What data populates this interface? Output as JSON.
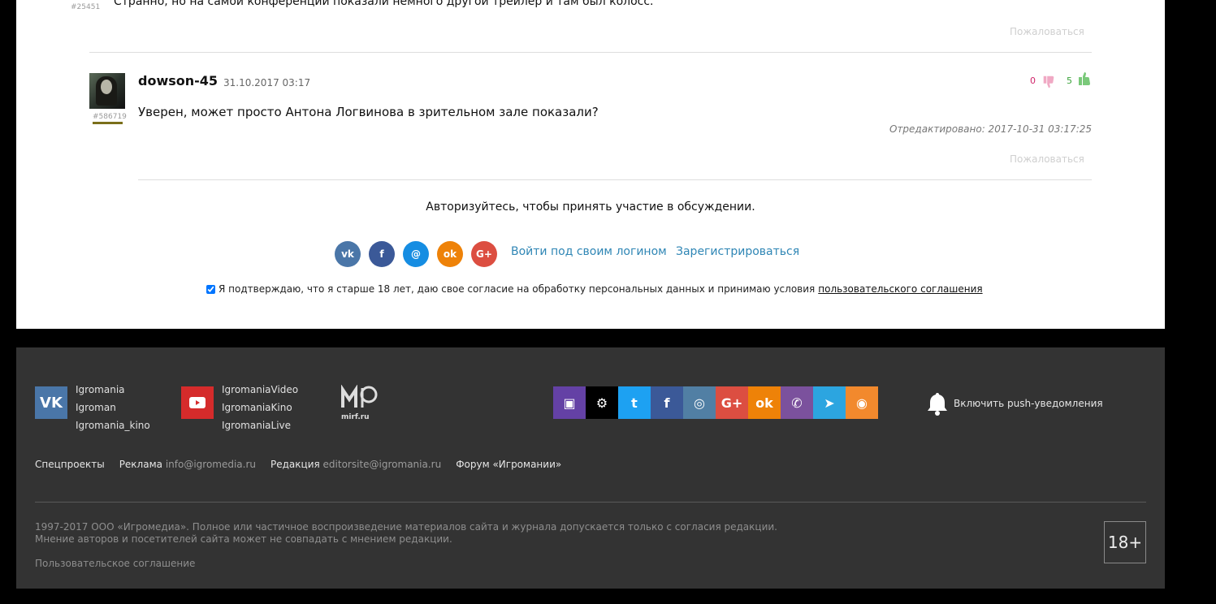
{
  "previous_comment": {
    "id_label": "#25451",
    "text": "Странно, но на самой конференции показали немного другой трейлер и там был колосс.",
    "complain_label": "Пожаловаться"
  },
  "comment": {
    "author": "dowson-45",
    "author_id": "#586719",
    "date": "31.10.2017 03:17",
    "downvotes": "0",
    "upvotes": "5",
    "text": "Уверен, может просто Антона Логвинова в зрительном зале показали?",
    "edited_label": "Отредактировано: 2017-10-31 03:17:25",
    "complain_label": "Пожаловаться"
  },
  "auth": {
    "message": "Авторизуйтесь, чтобы принять участие в обсуждении.",
    "social_icons": [
      "vk-icon",
      "facebook-icon",
      "mail-icon",
      "odnoklassniki-icon",
      "google-plus-icon"
    ],
    "login_link": "Войти под своим логином",
    "register_link": "Зарегистрироваться",
    "agreement_text": "Я подтверждаю, что я старше 18 лет, даю свое согласие на обработку персональных данных и принимаю условия",
    "agreement_link": "пользовательского соглашения",
    "agreement_checked": true
  },
  "footer": {
    "vk_links": [
      "Igromania",
      "Igroman",
      "Igromania_kino"
    ],
    "youtube_links": [
      "IgromaniaVideo",
      "IgromaniaKino",
      "IgromaniaLive"
    ],
    "mirf_label": "mirf.ru",
    "social_strip": [
      "twitch-icon",
      "steam-icon",
      "twitter-icon",
      "facebook-icon",
      "instagram-icon",
      "google-plus-icon",
      "odnoklassniki-icon",
      "viber-icon",
      "telegram-icon",
      "rss-icon"
    ],
    "push_label": "Включить push-уведомления",
    "nav": {
      "special_projects": "Спецпроекты",
      "ads_label": "Реклама",
      "ads_email": "info@igromedia.ru",
      "editorial_label": "Редакция",
      "editorial_email": "editorsite@igromania.ru",
      "forum": "Форум «Игромании»"
    },
    "copyright_line1": "1997-2017 ООО «Игромедиа». Полное или частичное воспроизведение материалов сайта и журнала допускается только с согласия редакции.",
    "copyright_line2": "Мнение авторов и посетителей сайта может не совпадать с мнением редакции.",
    "terms_link": "Пользовательское соглашение",
    "age_rating": "18+"
  },
  "colors": {
    "link": "#2f86b5",
    "downvote": "#d0256a",
    "upvote": "#3aa33a",
    "footer_bg": "#333333"
  }
}
